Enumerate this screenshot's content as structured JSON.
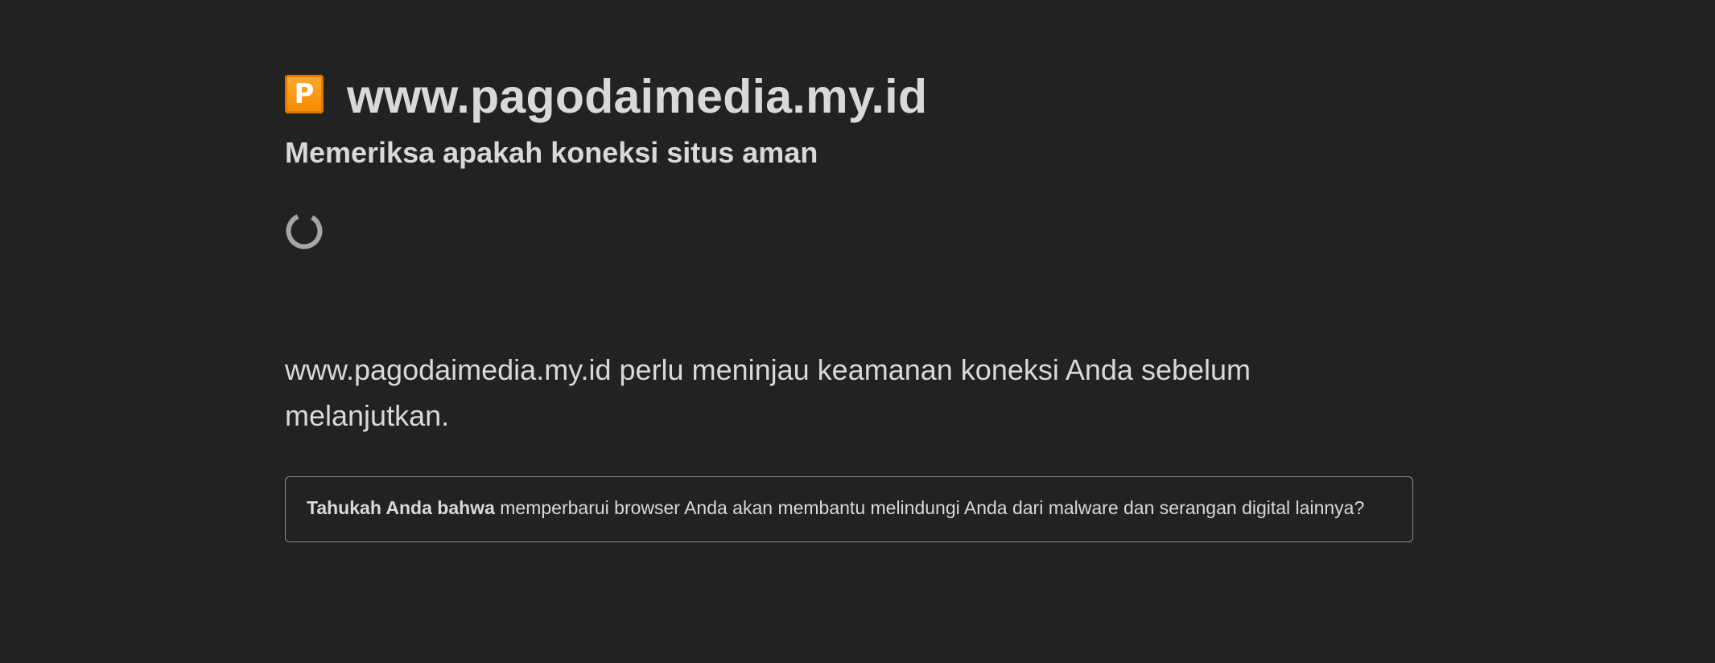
{
  "header": {
    "favicon_letter": "P",
    "site_name": "www.pagodaimedia.my.id",
    "subtitle": "Memeriksa apakah koneksi situs aman"
  },
  "spinner": {
    "icon": "loading-spinner-icon"
  },
  "message": {
    "text_line1": "www.pagodaimedia.my.id perlu meninjau keamanan koneksi Anda sebelum",
    "text_line2": "melanjutkan."
  },
  "tip": {
    "bold_lead": "Tahukah Anda bahwa",
    "body": " memperbarui browser Anda akan membantu melindungi Anda dari malware dan serangan digital lainnya?"
  },
  "colors": {
    "background": "#222222",
    "text": "#d9d9d9",
    "favicon": "#f28a00",
    "spinner": "#a6a6a6",
    "border": "#8c8c8c"
  }
}
